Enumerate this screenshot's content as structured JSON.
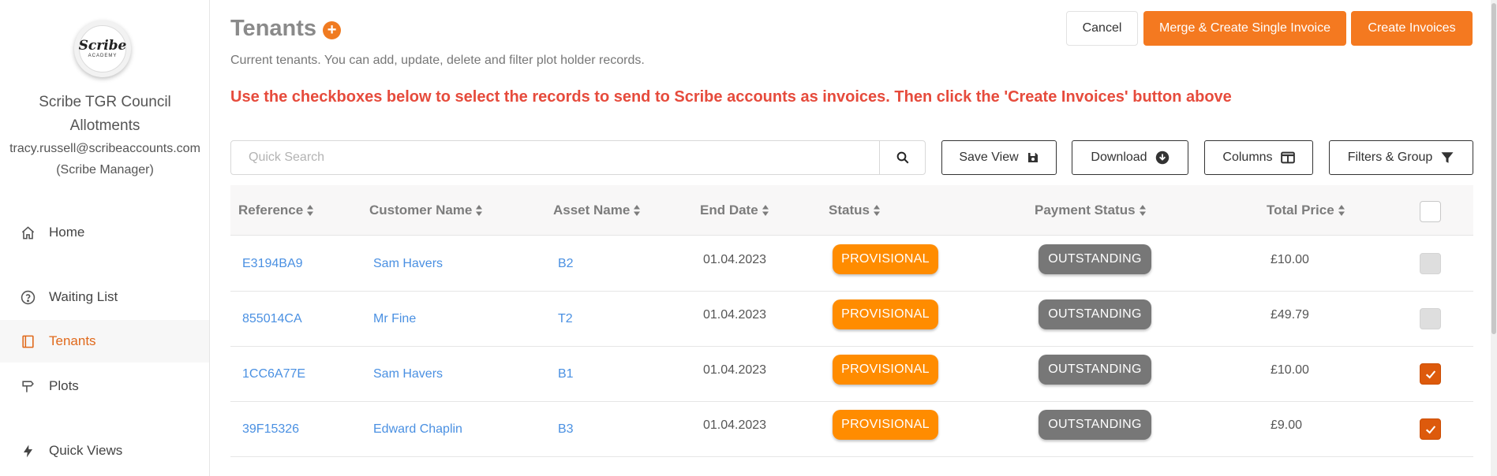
{
  "sidebar": {
    "logo_word": "Scribe",
    "logo_sub": "ACADEMY",
    "org_name": "Scribe TGR Council",
    "org_sub": "Allotments",
    "email": "tracy.russell@scribeaccounts.com",
    "role": "(Scribe Manager)",
    "items": [
      {
        "label": "Home",
        "icon": "home-icon"
      },
      {
        "label": "Waiting List",
        "icon": "question-circle-icon"
      },
      {
        "label": "Tenants",
        "icon": "book-icon",
        "active": true
      },
      {
        "label": "Plots",
        "icon": "signpost-icon"
      },
      {
        "label": "Quick Views",
        "icon": "lightning-icon"
      }
    ]
  },
  "header": {
    "title": "Tenants",
    "add_symbol": "+",
    "subtitle": "Current tenants. You can add, update, delete and filter plot holder records.",
    "instruction": "Use the checkboxes below to select the records to send to Scribe accounts as invoices. Then click the 'Create Invoices' button above",
    "cancel_label": "Cancel",
    "merge_label": "Merge & Create Single Invoice",
    "create_label": "Create Invoices"
  },
  "toolbar": {
    "search_placeholder": "Quick Search",
    "save_view_label": "Save View",
    "download_label": "Download",
    "columns_label": "Columns",
    "filters_label": "Filters & Group"
  },
  "table": {
    "columns": [
      "Reference",
      "Customer Name",
      "Asset Name",
      "End Date",
      "Status",
      "Payment Status",
      "Total Price"
    ],
    "rows": [
      {
        "reference": "E3194BA9",
        "customer": "Sam Havers",
        "asset": "B2",
        "end_date": "01.04.2023",
        "status": "PROVISIONAL",
        "payment": "OUTSTANDING",
        "price": "£10.00",
        "checked": false
      },
      {
        "reference": "855014CA",
        "customer": "Mr Fine",
        "asset": "T2",
        "end_date": "01.04.2023",
        "status": "PROVISIONAL",
        "payment": "OUTSTANDING",
        "price": "£49.79",
        "checked": false
      },
      {
        "reference": "1CC6A77E",
        "customer": "Sam Havers",
        "asset": "B1",
        "end_date": "01.04.2023",
        "status": "PROVISIONAL",
        "payment": "OUTSTANDING",
        "price": "£10.00",
        "checked": true
      },
      {
        "reference": "39F15326",
        "customer": "Edward Chaplin",
        "asset": "B3",
        "end_date": "01.04.2023",
        "status": "PROVISIONAL",
        "payment": "OUTSTANDING",
        "price": "£9.00",
        "checked": true
      }
    ]
  },
  "colors": {
    "accent": "#f47920",
    "provisional": "#ff8c00",
    "outstanding": "#777777",
    "instruction": "#e64b3c",
    "link": "#4a90e2"
  }
}
